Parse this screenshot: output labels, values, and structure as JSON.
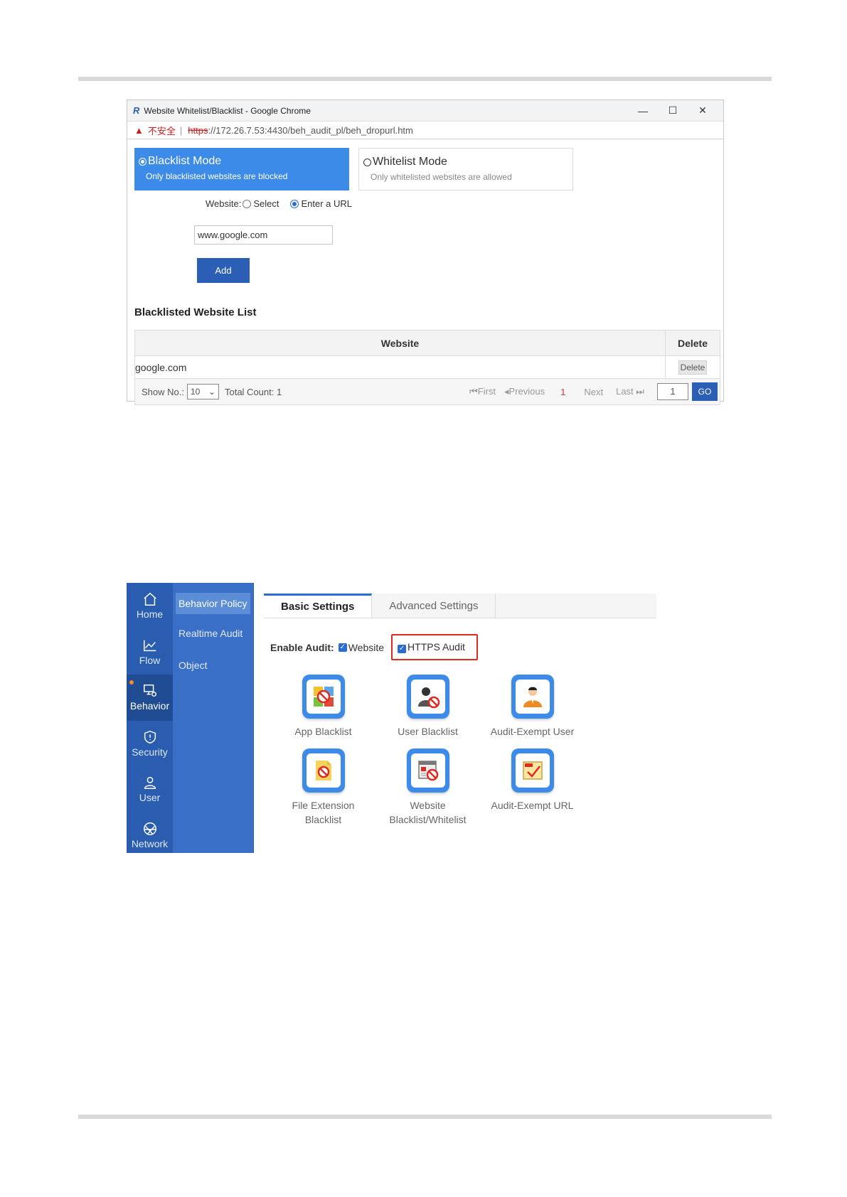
{
  "popup": {
    "window_title": "Website Whitelist/Blacklist - Google Chrome",
    "window_controls": {
      "minimize": "—",
      "maximize": "☐",
      "close": "✕"
    },
    "address": {
      "warning": "不安全",
      "separator": "|",
      "protocol": "https",
      "rest": "://172.26.7.53:4430/beh_audit_pl/beh_dropurl.htm"
    },
    "modes": {
      "blacklist": {
        "title": "Blacklist Mode",
        "desc": "Only blacklisted websites are blocked",
        "selected": true
      },
      "whitelist": {
        "title": "Whitelist Mode",
        "desc": "Only whitelisted websites are allowed",
        "selected": false
      }
    },
    "website_label": "Website:",
    "option_select": "Select",
    "option_enter_url": "Enter a URL",
    "url_value": "www.google.com",
    "add_label": "Add",
    "list_title": "Blacklisted Website List",
    "table": {
      "headers": [
        "Website",
        "Delete"
      ],
      "rows": [
        {
          "website": "google.com",
          "delete_label": "Delete"
        }
      ]
    },
    "pager": {
      "show_label": "Show No.:",
      "page_size": "10",
      "total_label": "Total Count: 1",
      "first": "First",
      "previous": "Previous",
      "current": "1",
      "next": "Next",
      "last": "Last",
      "page_input": "1",
      "go": "GO"
    }
  },
  "admin": {
    "primary_nav": [
      {
        "label": "Home",
        "icon": "home-icon"
      },
      {
        "label": "Flow",
        "icon": "chart-line-icon"
      },
      {
        "label": "Behavior",
        "icon": "behavior-icon",
        "active": true
      },
      {
        "label": "Security",
        "icon": "shield-icon"
      },
      {
        "label": "User",
        "icon": "user-icon"
      },
      {
        "label": "Network",
        "icon": "network-icon"
      }
    ],
    "secondary_nav": [
      {
        "label": "Behavior Policy",
        "active": true
      },
      {
        "label": "Realtime Audit"
      },
      {
        "label": "Object"
      }
    ],
    "tabs": [
      {
        "label": "Basic Settings",
        "active": true
      },
      {
        "label": "Advanced Settings"
      }
    ],
    "enable_audit_label": "Enable Audit:",
    "checkbox_website": "Website",
    "checkbox_https": "HTTPS Audit",
    "features": [
      {
        "label": "App Blacklist",
        "icon": "app-blacklist-icon"
      },
      {
        "label": "User Blacklist",
        "icon": "user-blacklist-icon"
      },
      {
        "label": "Audit-Exempt User",
        "icon": "audit-exempt-user-icon"
      },
      {
        "label": "File Extension Blacklist",
        "icon": "file-extension-blacklist-icon"
      },
      {
        "label": "Website Blacklist/Whitelist",
        "icon": "website-blacklist-icon"
      },
      {
        "label": "Audit-Exempt URL",
        "icon": "audit-exempt-url-icon"
      }
    ],
    "colors": {
      "nav": "#2a5db0",
      "accent": "#2a6cd1",
      "highlight": "#e0291f"
    }
  }
}
